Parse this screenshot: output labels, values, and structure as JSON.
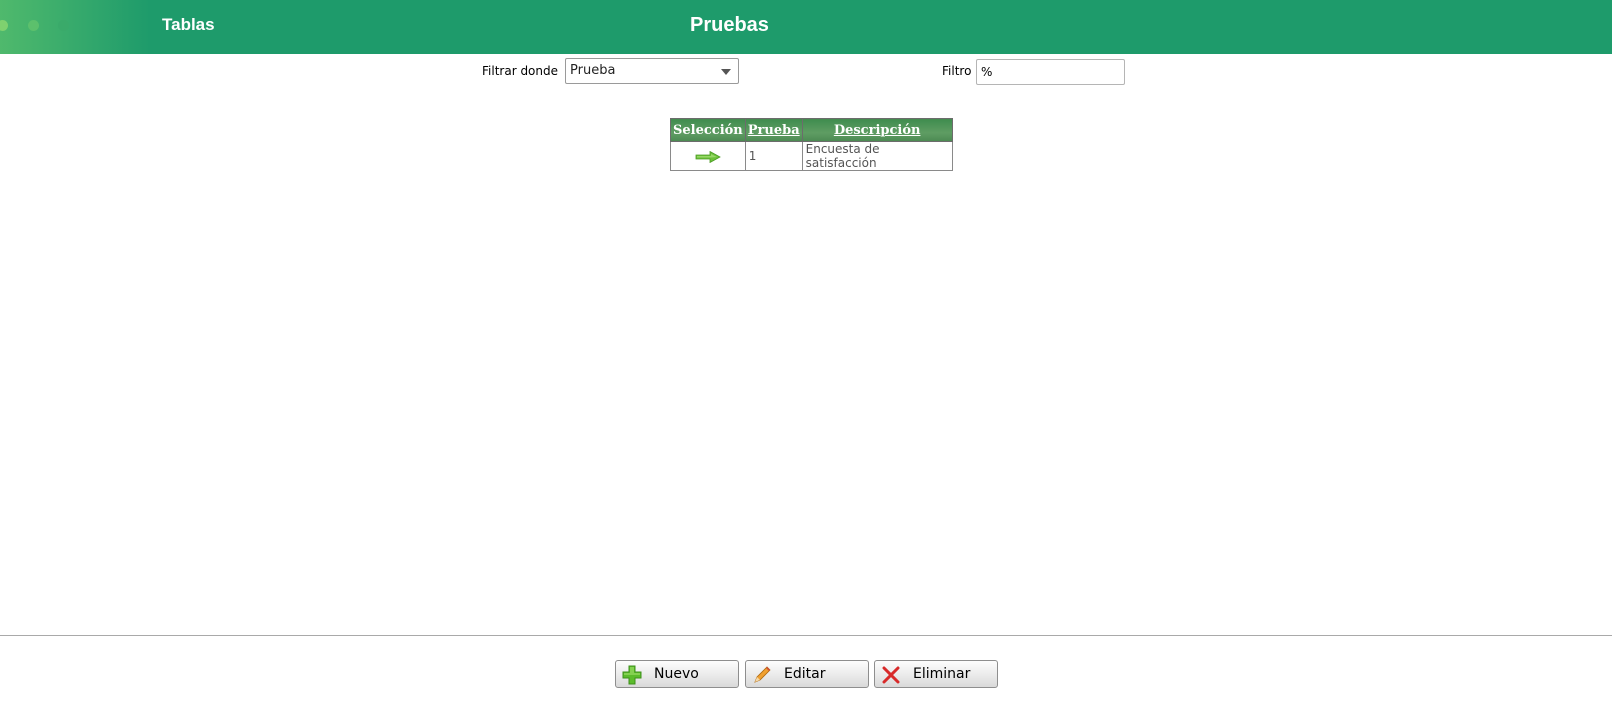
{
  "header": {
    "section": "Tablas",
    "title": "Pruebas",
    "background_color": "#1e9b6b"
  },
  "filters": {
    "filter_by_label": "Filtrar donde",
    "filter_by_value": "Prueba",
    "filter_label": "Filtro",
    "filter_value": "%"
  },
  "table": {
    "columns": [
      "Selección",
      "Prueba",
      "Descripción"
    ],
    "rows": [
      {
        "select_icon": "right-arrow-icon",
        "prueba": "1",
        "descripcion": "Encuesta de satisfacción"
      }
    ]
  },
  "buttons": {
    "new_label": "Nuevo",
    "edit_label": "Editar",
    "delete_label": "Eliminar",
    "new_icon": "plus-icon",
    "edit_icon": "pencil-icon",
    "delete_icon": "x-icon"
  }
}
